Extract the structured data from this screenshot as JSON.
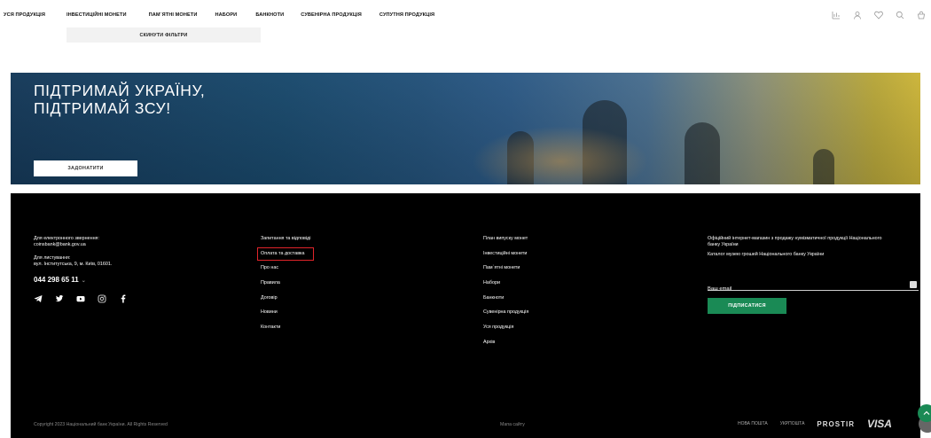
{
  "nav": {
    "items": [
      "Уся продукція",
      "Інвестиційні монети",
      "Пам`ятні монети",
      "Набори",
      "Банкноти",
      "Сувенірна продукція",
      "Супутня продукція"
    ]
  },
  "header_icons": [
    "compare-icon",
    "profile-icon",
    "heart-icon",
    "search-icon",
    "cart-icon"
  ],
  "filters": {
    "reset_label": "СКИНУТИ ФІЛЬТРИ"
  },
  "banner": {
    "title_line1": "ПІДТРИМАЙ УКРАЇНУ,",
    "title_line2": "ПІДТРИМАЙ ЗСУ!",
    "donate_label": "ЗАДОНАТИТИ"
  },
  "footer": {
    "contact": {
      "email_label": "Для електронного звернення:",
      "email": "coinsbank@bank.gov.ua",
      "post_label": "Для листування:",
      "address": "вул. Інститутська, 9, м. Київ, 01601.",
      "phone": "044 298 65 11",
      "phone_chevron": "⌄"
    },
    "social": [
      "telegram-icon",
      "twitter-icon",
      "youtube-icon",
      "instagram-icon",
      "facebook-icon"
    ],
    "links_col1": [
      "Запитання та відповіді",
      "Оплата та доставка",
      "Про нас",
      "Правила",
      "Договір",
      "Новини",
      "Контакти"
    ],
    "highlighted_link_index": 1,
    "links_col2": [
      "План випуску монет",
      "Інвестиційні монети",
      "Пам`ятні монети",
      "Набори",
      "Банкноти",
      "Сувенірна продукція",
      "Уся продукція",
      "Архів"
    ],
    "about_line1": "Офіційний інтернет-магазин з продажу нумізматичної продукції Національного",
    "about_line2": "банку України",
    "catalog": "Каталог музею грошей Національного банку України",
    "email_placeholder": "Ваш email",
    "subscribe_label": "ПІДПИСАТИСЯ",
    "copyright": "Copyright 2023 Національний банк України. All Rights Reserved",
    "sitemap": "Мапа сайту",
    "payments": [
      "НОВА ПОШТА",
      "УКРПОШТА",
      "PROSTIR",
      "VISA"
    ]
  },
  "colors": {
    "accent": "#1a8a55",
    "highlight": "#e0242a",
    "footer_bg": "#000000"
  }
}
